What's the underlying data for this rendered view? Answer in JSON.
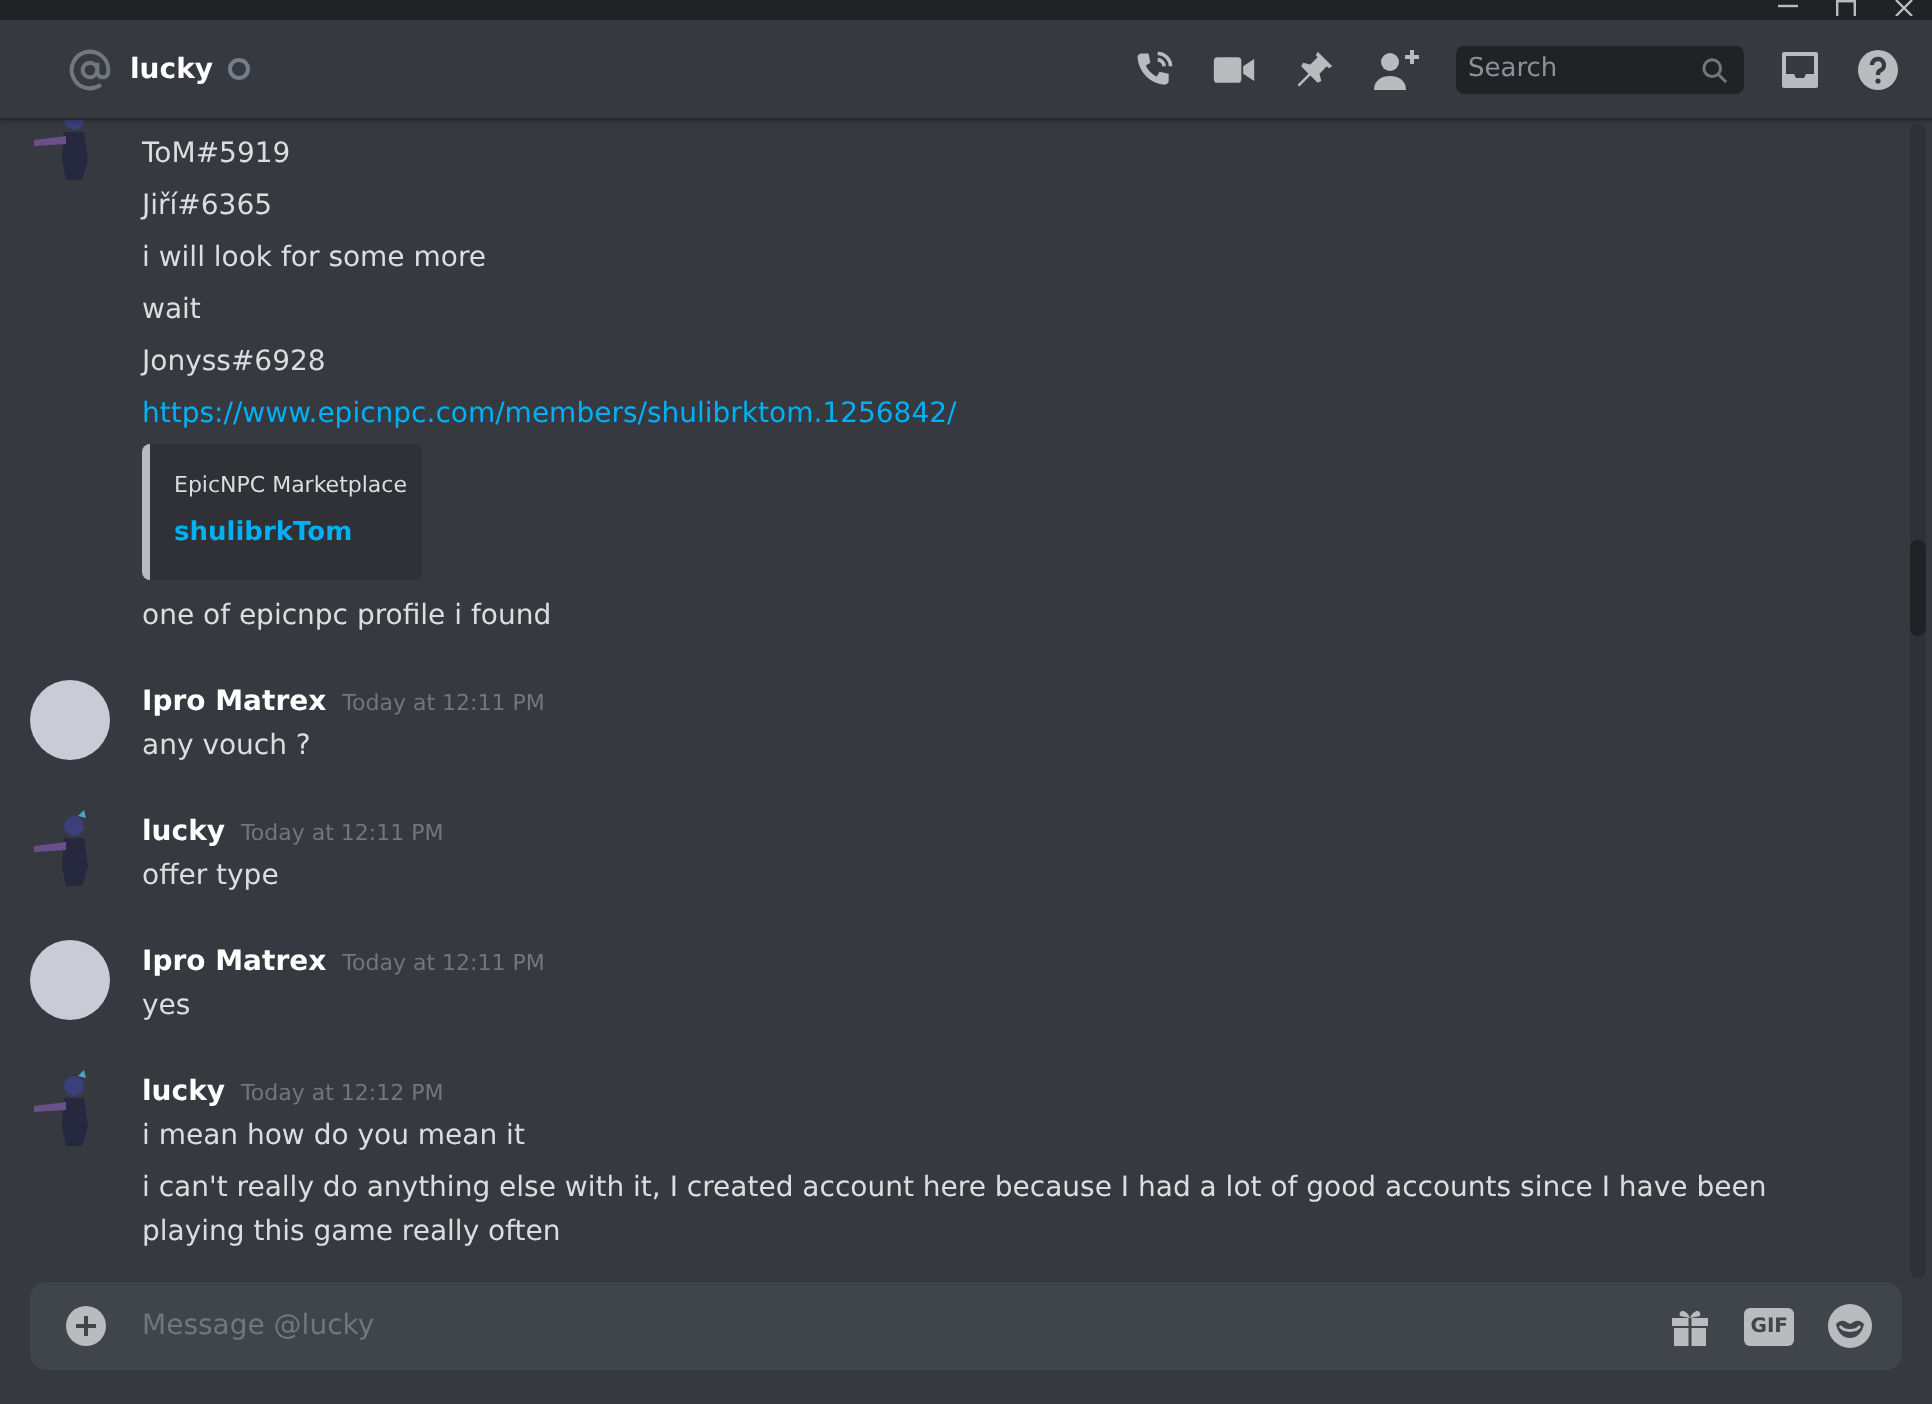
{
  "channel": {
    "name": "lucky",
    "offline": true
  },
  "search": {
    "placeholder": "Search"
  },
  "messages": [
    {
      "kind": "figure",
      "lines": [
        {
          "kind": "text",
          "text": "ToM#5919"
        },
        {
          "kind": "text",
          "text": "Jiří#6365"
        },
        {
          "kind": "text",
          "text": "i will look for some more"
        },
        {
          "kind": "text",
          "text": "wait"
        },
        {
          "kind": "text",
          "text": "Jonyss#6928"
        },
        {
          "kind": "link",
          "text": "https://www.epicnpc.com/members/shulibrktom.1256842/"
        },
        {
          "kind": "embed",
          "provider": "EpicNPC Marketplace",
          "title": "shulibrkTom"
        },
        {
          "kind": "text",
          "text": "one of epicnpc profile i found"
        }
      ]
    },
    {
      "kind": "portrait",
      "author": "Ipro Matrex",
      "timestamp": "Today at 12:11 PM",
      "lines": [
        {
          "kind": "text",
          "text": "any vouch ?"
        }
      ]
    },
    {
      "kind": "figure",
      "author": "lucky",
      "timestamp": "Today at 12:11 PM",
      "lines": [
        {
          "kind": "text",
          "text": "offer type"
        }
      ]
    },
    {
      "kind": "portrait",
      "author": "Ipro Matrex",
      "timestamp": "Today at 12:11 PM",
      "lines": [
        {
          "kind": "text",
          "text": "yes"
        }
      ]
    },
    {
      "kind": "figure",
      "author": "lucky",
      "timestamp": "Today at 12:12 PM",
      "lines": [
        {
          "kind": "text",
          "text": "i mean how do you mean it"
        },
        {
          "kind": "text",
          "text": "i can't really do anything else with it, I created account here because I had a lot of good accounts since I have been playing this game really often"
        }
      ]
    }
  ],
  "composer": {
    "placeholder": "Message @lucky",
    "gif_label": "GIF"
  }
}
